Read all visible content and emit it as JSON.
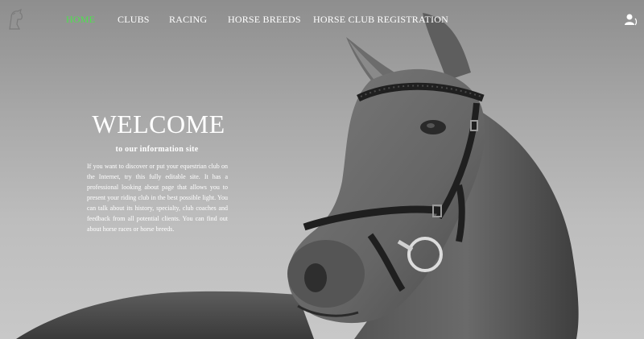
{
  "nav": {
    "logo_icon": "horse-logo-icon",
    "items": [
      {
        "label": "HOME",
        "active": true
      },
      {
        "label": "CLUBS",
        "active": false
      },
      {
        "label": "RACING",
        "active": false
      },
      {
        "label": "HORSE BREEDS",
        "active": false
      },
      {
        "label": "HORSE CLUB REGISTRATION",
        "active": false
      }
    ],
    "user_icon": "user-icon"
  },
  "hero": {
    "title": "WELCOME",
    "subtitle": "to our information site",
    "body": "If you want to discover or put your equestrian club on the Internet, try this fully editable site. It has a professional looking about page that allows you to present your riding club in the best possible light. You can talk about its history, specialty, club coaches and feedback from all potential clients. You can find out about horse races or horse breeds."
  },
  "colors": {
    "active_nav": "#4fe04f",
    "text": "#ffffff"
  }
}
